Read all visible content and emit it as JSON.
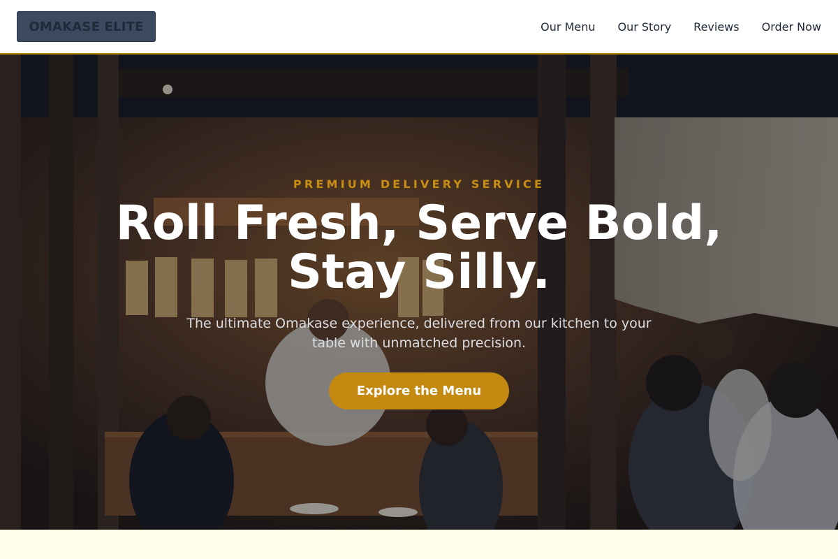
{
  "nav": {
    "logo": "OMAKASE ELITE",
    "links": [
      "Our Menu",
      "Our Story",
      "Reviews",
      "Order Now"
    ]
  },
  "hero": {
    "eyebrow": "PREMIUM DELIVERY SERVICE",
    "headline": "Roll Fresh, Serve Bold, Stay Silly.",
    "subhead": "The ultimate Omakase experience, delivered from our kitchen to your table with unmatched precision.",
    "cta": "Explore the Menu"
  },
  "colors": {
    "accent": "#c38910",
    "nav_border": "#b8860b",
    "logo_bg": "#3b4a5e",
    "page_bg": "#fefee9"
  }
}
